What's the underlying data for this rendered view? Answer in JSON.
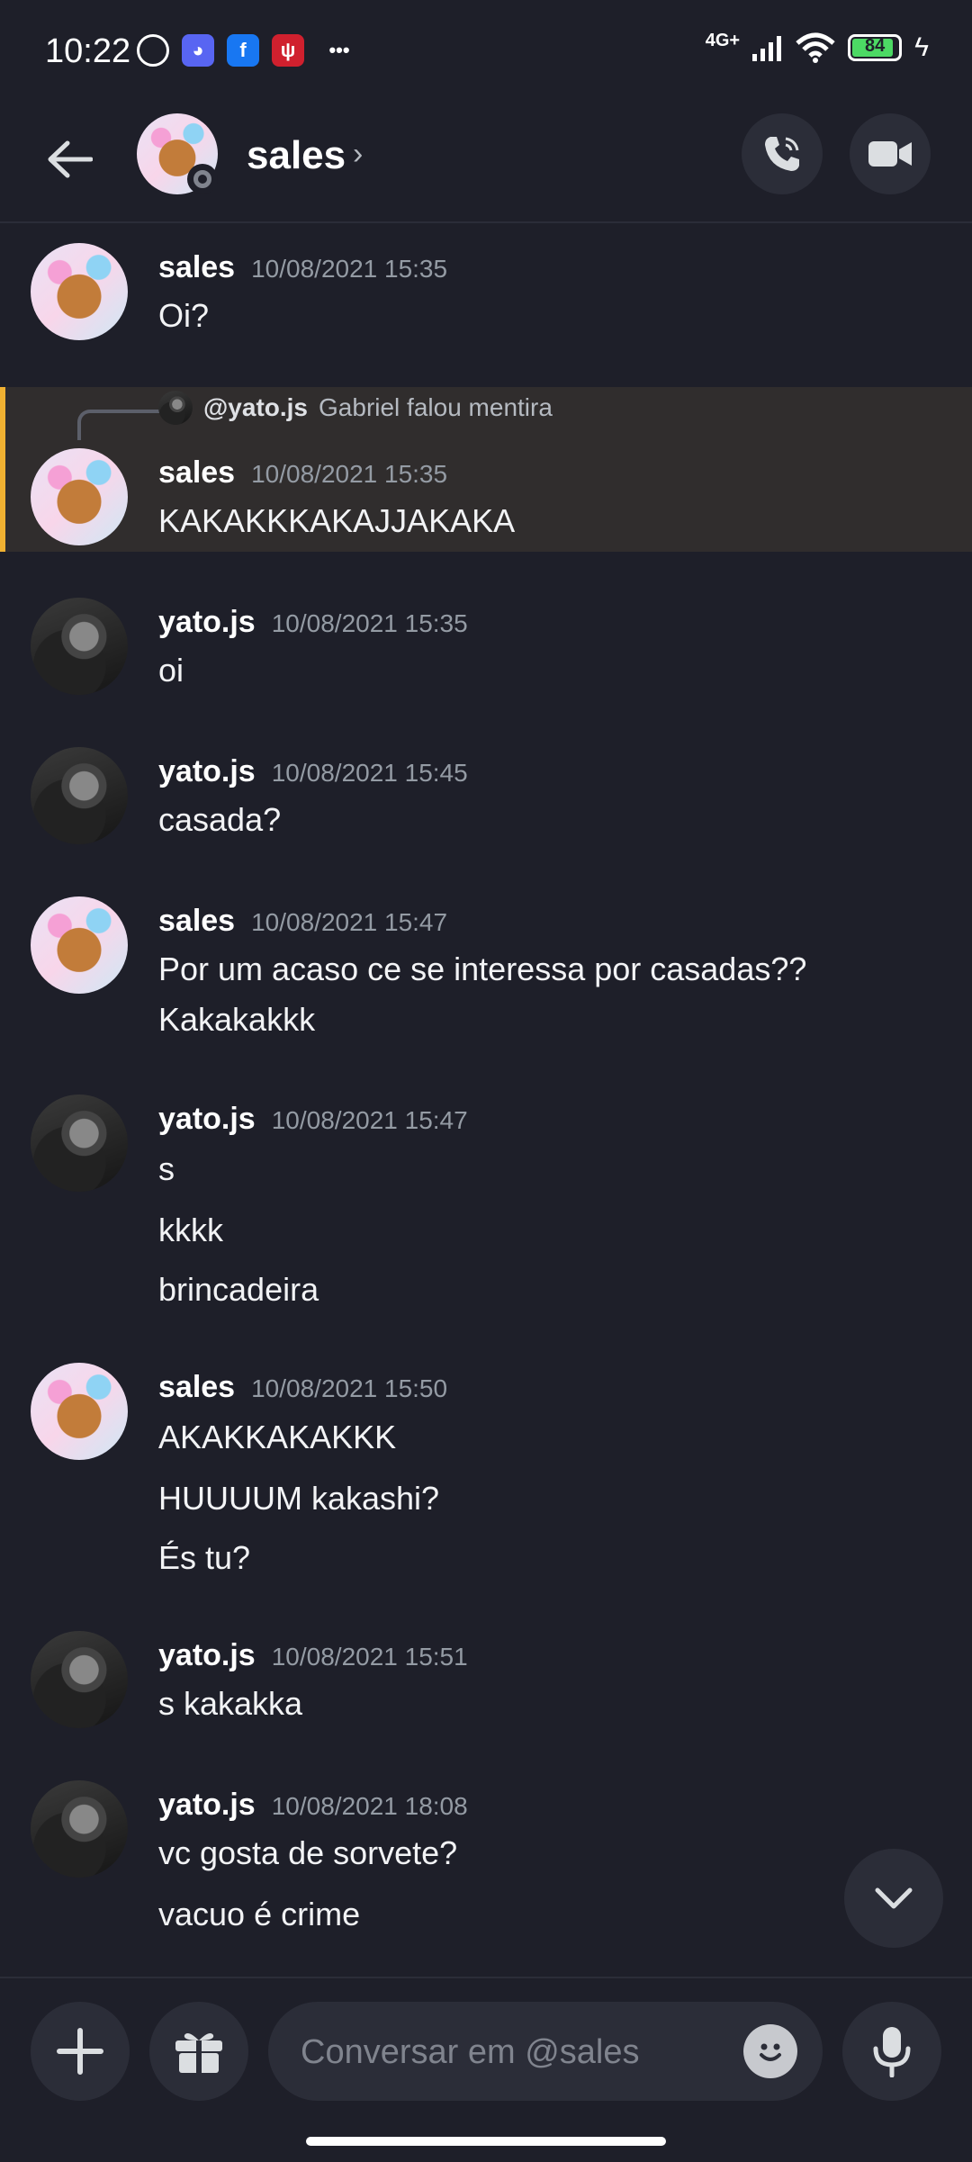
{
  "status_bar": {
    "time": "10:22",
    "network": "4G+",
    "battery": "84"
  },
  "header": {
    "name": "sales",
    "chevron": "›"
  },
  "reply": {
    "author": "@yato.js",
    "text": "Gabriel falou mentira"
  },
  "messages": [
    {
      "author": "sales",
      "time": "10/08/2021 15:35",
      "lines": [
        "Oi?"
      ]
    },
    {
      "author": "sales",
      "time": "10/08/2021 15:35",
      "lines": [
        "KAKAKKKAKAJJAKAKA"
      ]
    },
    {
      "author": "yato.js",
      "time": "10/08/2021 15:35",
      "lines": [
        "oi"
      ]
    },
    {
      "author": "yato.js",
      "time": "10/08/2021 15:45",
      "lines": [
        "casada?"
      ]
    },
    {
      "author": "sales",
      "time": "10/08/2021 15:47",
      "lines": [
        "Por um acaso ce se interessa por casadas??",
        "Kakakakkk"
      ]
    },
    {
      "author": "yato.js",
      "time": "10/08/2021 15:47",
      "lines": [
        "s",
        "kkkk",
        "brincadeira"
      ]
    },
    {
      "author": "sales",
      "time": "10/08/2021 15:50",
      "lines": [
        "AKAKKAKAKKK",
        "HUUUUM kakashi?",
        "És tu?"
      ]
    },
    {
      "author": "yato.js",
      "time": "10/08/2021 15:51",
      "lines": [
        "s kakakka"
      ]
    },
    {
      "author": "yato.js",
      "time": "10/08/2021 18:08",
      "lines": [
        "vc gosta de sorvete?",
        "vacuo é crime"
      ]
    }
  ],
  "composer": {
    "placeholder": "Conversar em @sales"
  },
  "colors": {
    "background": "#1e1f29",
    "highlight": "#302d2d",
    "mention_bar": "#f0b132",
    "battery": "#4cd964"
  },
  "icons": [
    "alarm-icon",
    "discord-icon",
    "facebook-icon",
    "app-icon",
    "more-icon",
    "signal-icon",
    "wifi-icon",
    "battery-icon",
    "charging-icon",
    "back-arrow-icon",
    "phone-call-icon",
    "video-camera-icon",
    "chevron-down-icon",
    "plus-icon",
    "gift-icon",
    "emoji-icon",
    "microphone-icon"
  ]
}
